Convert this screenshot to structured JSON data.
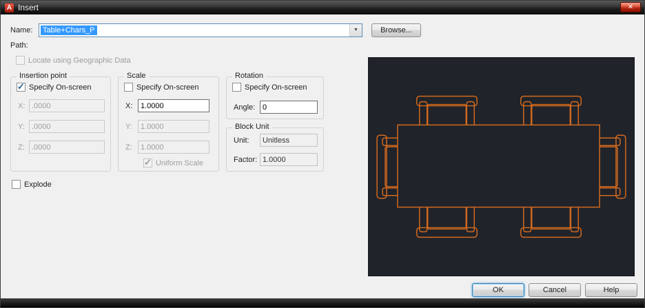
{
  "window": {
    "title": "Insert"
  },
  "icons": {
    "close": "✕",
    "dropdown": "▼",
    "check": "✓",
    "app_badge": "A"
  },
  "colors": {
    "selection": "#3399ff",
    "preview_background": "#20232a",
    "preview_line": "#d2691e"
  },
  "name_row": {
    "label": "Name:",
    "value": "Table+Chars_P",
    "browse": "Browse..."
  },
  "path_label": "Path:",
  "geo": {
    "label": "Locate using Geographic Data",
    "checked": false,
    "enabled": false
  },
  "insertion": {
    "title": "Insertion point",
    "specify": "Specify On-screen",
    "specify_checked": true,
    "x_label": "X:",
    "x_value": ".0000",
    "y_label": "Y:",
    "y_value": ".0000",
    "z_label": "Z:",
    "z_value": ".0000"
  },
  "scale": {
    "title": "Scale",
    "specify": "Specify On-screen",
    "specify_checked": false,
    "x_label": "X:",
    "x_value": "1.0000",
    "y_label": "Y:",
    "y_value": "1.0000",
    "z_label": "Z:",
    "z_value": "1.0000",
    "uniform": "Uniform Scale",
    "uniform_checked": true,
    "uniform_enabled": false
  },
  "rotation": {
    "title": "Rotation",
    "specify": "Specify On-screen",
    "specify_checked": false,
    "angle_label": "Angle:",
    "angle_value": "0"
  },
  "block_unit": {
    "title": "Block Unit",
    "unit_label": "Unit:",
    "unit_value": "Unitless",
    "factor_label": "Factor:",
    "factor_value": "1.0000"
  },
  "explode": {
    "label": "Explode",
    "checked": false
  },
  "buttons": {
    "ok": "OK",
    "cancel": "Cancel",
    "help": "Help"
  },
  "preview": {
    "content": "table-with-six-chairs-block"
  }
}
